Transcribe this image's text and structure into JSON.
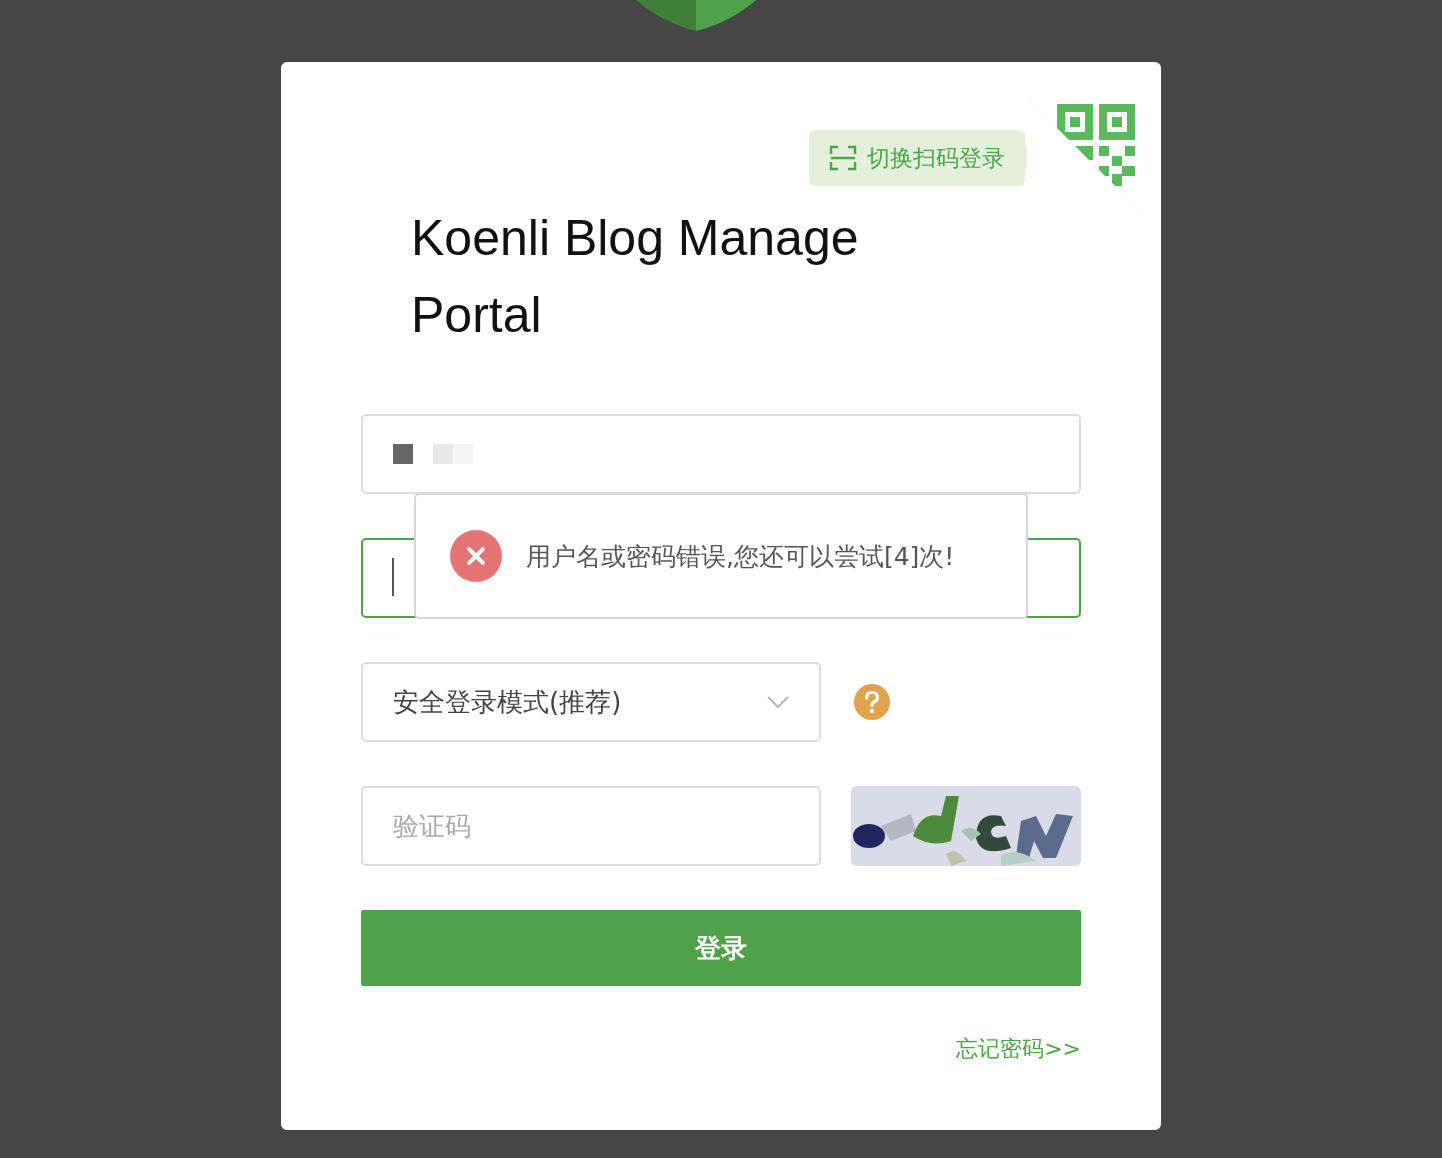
{
  "qr_switch": {
    "label": "切换扫码登录"
  },
  "title": "Koenli Blog Manage Portal",
  "username": {
    "value_redacted": true
  },
  "password": {
    "focused": true
  },
  "toast": {
    "kind": "error",
    "message": "用户名或密码错误,您还可以尝试[4]次!"
  },
  "mode_select": {
    "value": "安全登录模式(推荐)"
  },
  "captcha": {
    "placeholder": "验证码"
  },
  "login_button": {
    "label": "登录"
  },
  "forgot_link": {
    "label": "忘记密码>>"
  }
}
